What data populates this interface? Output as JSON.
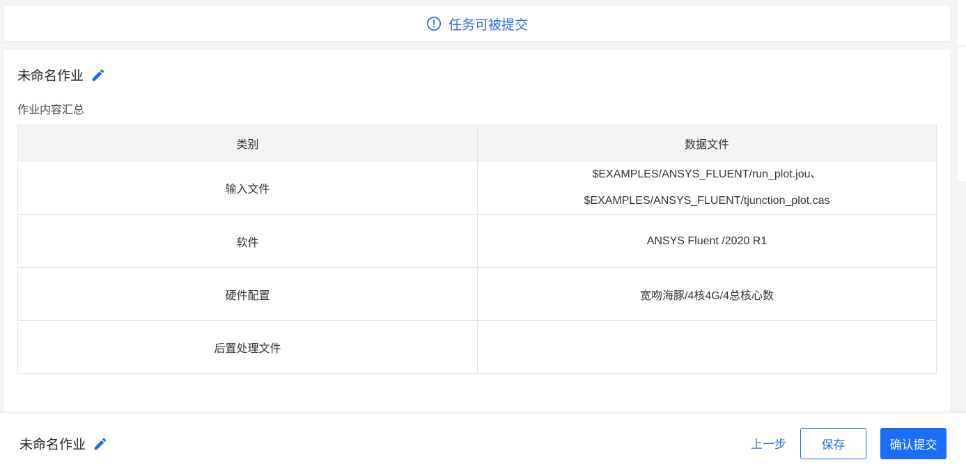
{
  "banner": {
    "icon": "info-circle-icon",
    "text": "任务可被提交",
    "color": "#2b6fe0"
  },
  "job": {
    "title": "未命名作业",
    "edit_icon": "pencil-icon"
  },
  "summary": {
    "label": "作业内容汇总",
    "columns": [
      "类别",
      "数据文件"
    ],
    "rows": [
      {
        "category": "输入文件",
        "values": [
          "$EXAMPLES/ANSYS_FLUENT/run_plot.jou、",
          "$EXAMPLES/ANSYS_FLUENT/tjunction_plot.cas"
        ]
      },
      {
        "category": "软件",
        "values": [
          "ANSYS Fluent /2020 R1"
        ]
      },
      {
        "category": "硬件配置",
        "values": [
          "宽吻海豚/4核4G/4总核心数"
        ]
      },
      {
        "category": "后置处理文件",
        "values": []
      }
    ]
  },
  "footer": {
    "title": "未命名作业",
    "prev_label": "上一步",
    "save_label": "保存",
    "submit_label": "确认提交",
    "accent_color": "#1a6ef5"
  }
}
